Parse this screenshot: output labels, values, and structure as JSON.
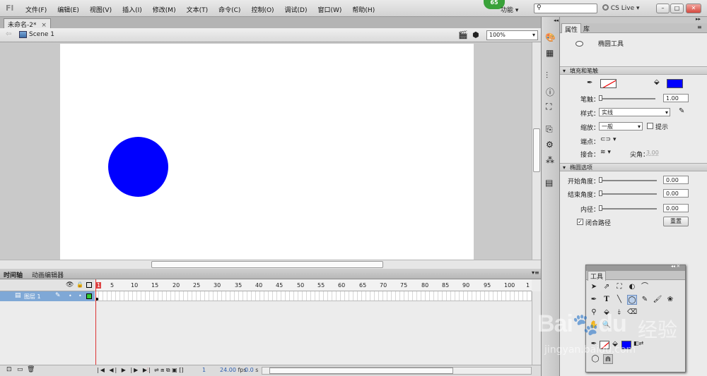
{
  "menubar": {
    "logo": "Fl",
    "items": [
      "文件(F)",
      "编辑(E)",
      "视图(V)",
      "插入(I)",
      "修改(M)",
      "文本(T)",
      "命令(C)",
      "控制(O)",
      "调试(D)",
      "窗口(W)",
      "帮助(H)"
    ],
    "badge": "65",
    "workspace": "功能",
    "cslive": "CS Live"
  },
  "document": {
    "tab": "未命名-2*",
    "tab_close": "×",
    "scene": "Scene 1",
    "zoom": "100%"
  },
  "timeline": {
    "tabs": [
      "时间轴",
      "动画编辑器"
    ],
    "layer": "图层 1",
    "ruler": [
      "1",
      "5",
      "10",
      "15",
      "20",
      "25",
      "30",
      "35",
      "40",
      "45",
      "50",
      "55",
      "60",
      "65",
      "70",
      "75",
      "80",
      "85",
      "90",
      "95",
      "100",
      "1"
    ],
    "current_frame": "1",
    "fps": "24.00",
    "fps_unit": "fps",
    "time": "0.0",
    "time_unit": "s"
  },
  "properties": {
    "tabs": [
      "属性",
      "库"
    ],
    "tool_name": "椭圆工具",
    "section_fill": "填充和笔触",
    "stroke_label": "笔触：",
    "stroke_value": "1.00",
    "style_label": "样式：",
    "style_value": "实线",
    "scale_label": "缩放：",
    "scale_value": "一般",
    "hint_label": "提示",
    "cap_label": "端点：",
    "join_label": "接合：",
    "miter_label": "尖角：",
    "miter_value": "3.00",
    "section_oval": "椭圆选项",
    "start_label": "开始角度：",
    "start_value": "0.00",
    "end_label": "结束角度：",
    "end_value": "0.00",
    "inner_label": "内径：",
    "inner_value": "0.00",
    "close_path_label": "闭合路径",
    "reset_label": "重置",
    "fill_color": "#0000ff",
    "stroke_color": "none"
  },
  "tools": {
    "title": "工具"
  },
  "watermark": {
    "brand": "Bai",
    "brand2": "du",
    "cn": "经验",
    "url": "jingyan.baidu.com"
  }
}
